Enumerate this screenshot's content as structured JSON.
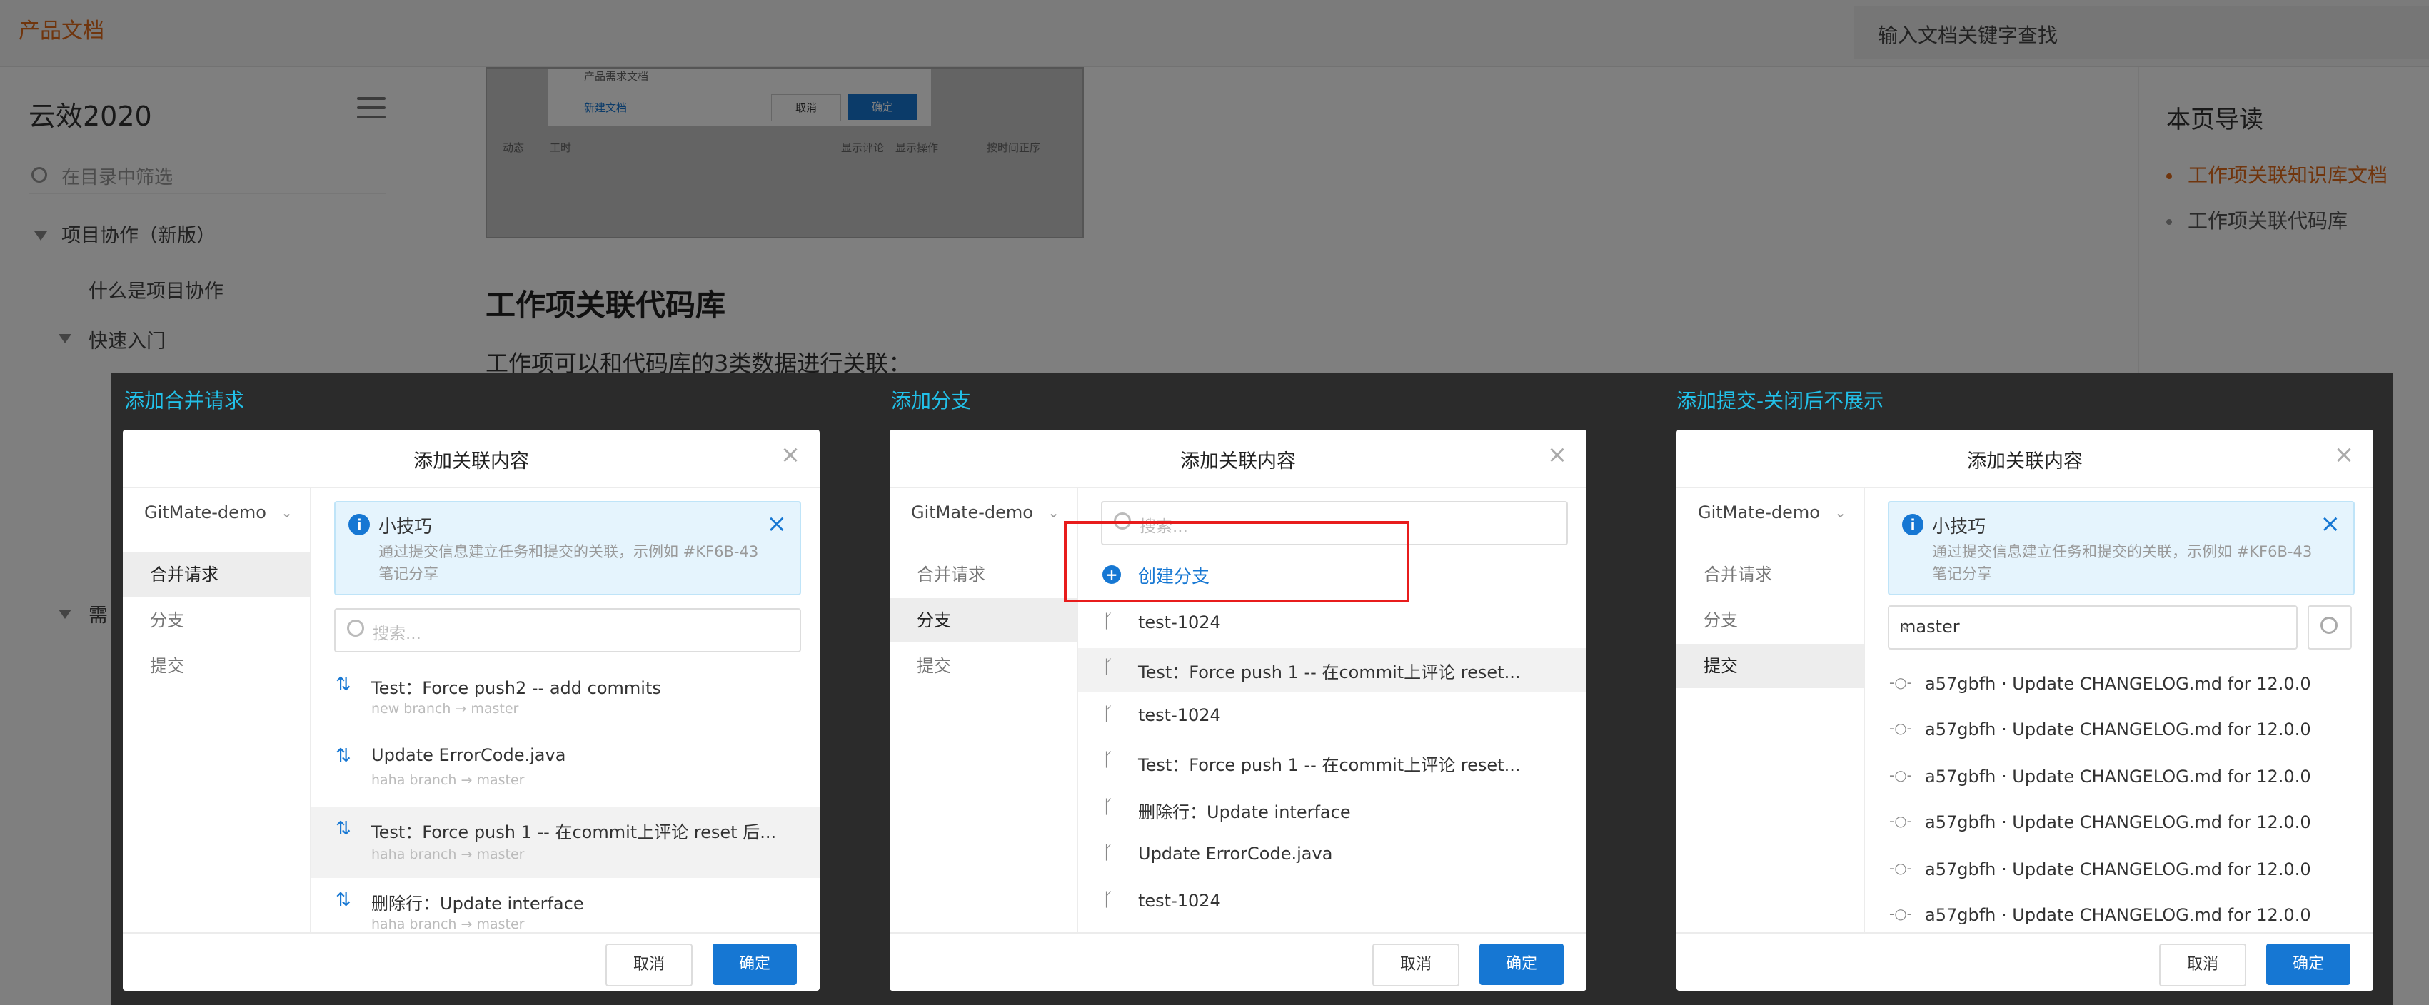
{
  "topbar": {
    "brand": "产品文档",
    "search_placeholder": "输入文档关键字查找"
  },
  "sidebar": {
    "title": "云效2020",
    "filter_placeholder": "在目录中筛选",
    "items": [
      "项目协作（新版）",
      "什么是项目协作",
      "快速入门",
      "需"
    ]
  },
  "content": {
    "snap_texts": [
      "产品需求文档",
      "新建文档",
      "取消",
      "确定",
      "动态",
      "工时",
      "显示评论",
      "显示操作",
      "按时间正序"
    ],
    "heading": "工作项关联代码库",
    "paragraph": "工作项可以和代码库的3类数据进行关联："
  },
  "toc": {
    "title": "本页导读",
    "items": [
      "工作项关联知识库文档",
      "工作项关联代码库"
    ]
  },
  "sections": {
    "merge": "添加合并请求",
    "branch": "添加分支",
    "commit": "添加提交-关闭后不展示"
  },
  "dialog": {
    "title": "添加关联内容",
    "repo": "GitMate-demo",
    "nav": [
      "合并请求",
      "分支",
      "提交"
    ],
    "cancel": "取消",
    "ok": "确定",
    "tip_title": "小技巧",
    "tip_body": "通过提交信息建立任务和提交的关联，示例如 #KF6B-43 笔记分享",
    "search_placeholder": "搜索..."
  },
  "merge_list": [
    {
      "title": "Test：Force push2 -- add commits",
      "sub": "new branch  →  master"
    },
    {
      "title": "Update ErrorCode.java",
      "sub": "haha branch  →  master"
    },
    {
      "title": "Test：Force push 1 -- 在commit上评论 reset 后...",
      "sub": "haha branch  →  master"
    },
    {
      "title": "删除行：Update interface",
      "sub": "haha branch  →  master"
    }
  ],
  "branch_panel": {
    "create": "创建分支",
    "items": [
      "test-1024",
      "Test：Force push 1 -- 在commit上评论 reset...",
      "test-1024",
      "Test：Force push 1 -- 在commit上评论 reset...",
      "删除行：Update interface",
      "Update ErrorCode.java",
      "test-1024"
    ]
  },
  "commit_panel": {
    "branch": "master",
    "items": [
      "a57gbfh · Update CHANGELOG.md for 12.0.0",
      "a57gbfh · Update CHANGELOG.md for 12.0.0",
      "a57gbfh · Update CHANGELOG.md for 12.0.0",
      "a57gbfh · Update CHANGELOG.md for 12.0.0",
      "a57gbfh · Update CHANGELOG.md for 12.0.0",
      "a57gbfh · Update CHANGELOG.md for 12.0.0"
    ]
  },
  "colors": {
    "accent": "#1677d3",
    "brand": "#e06a1b",
    "section_label": "#22c0e8",
    "highlight_box": "#e81c1c"
  }
}
